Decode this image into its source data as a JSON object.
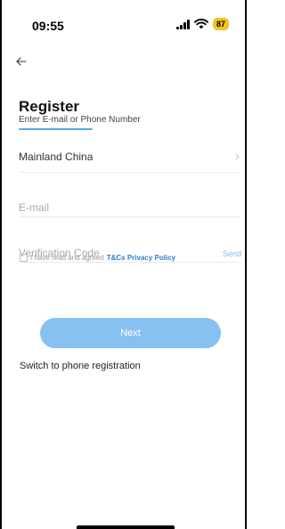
{
  "status_bar": {
    "time": "09:55",
    "battery": "87",
    "battery_color": "#f7c21b",
    "icons": [
      "signal-icon",
      "wifi-icon"
    ]
  },
  "header": {
    "back_icon": "arrow-left-icon",
    "title": "Register",
    "subtitle": "Enter E-mail or Phone Number"
  },
  "form": {
    "region": {
      "label": "Mainland China",
      "icon": "chevron-right-icon"
    },
    "email": {
      "placeholder": "E-mail",
      "value": ""
    },
    "verification": {
      "placeholder": "Verification Code",
      "value": "",
      "send_label": "Send"
    },
    "agreement": {
      "text": "I have read and agreed",
      "links": "T&Cs Privacy Policy",
      "checked": false
    },
    "next_label": "Next",
    "switch_label": "Switch to phone registration"
  },
  "colors": {
    "accent": "#86c1f1",
    "link": "#2d7fd0",
    "underline": "#5aa9e6"
  }
}
